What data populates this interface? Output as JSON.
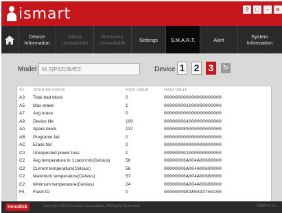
{
  "app": {
    "brand": "ismart"
  },
  "window_buttons": [
    "?",
    "□",
    "–",
    "×"
  ],
  "nav": {
    "home_icon": "home-icon",
    "items": [
      {
        "label": "Device Information",
        "state": "enabled"
      },
      {
        "label": "Ghost Unavailable",
        "state": "disabled"
      },
      {
        "label": "Recovery Unavailable",
        "state": "disabled"
      },
      {
        "label": "Settings",
        "state": "enabled"
      },
      {
        "label": "S.M.A.R.T.",
        "state": "active"
      },
      {
        "label": "Alert",
        "state": "enabled"
      },
      {
        "label": "System Information",
        "state": "enabled"
      }
    ]
  },
  "model": {
    "label": "Model",
    "value": "M.2(P42)3ME2"
  },
  "device": {
    "label": "Device",
    "buttons": [
      "1",
      "2",
      "3"
    ],
    "selected": "3",
    "refresh_icon": "refresh-icon"
  },
  "table": {
    "headers": [
      "ID",
      "Attribute Name",
      "Raw Value",
      "Raw Value"
    ],
    "rows": [
      [
        "A3",
        "Total bad block",
        "0",
        "000000000000000000000"
      ],
      [
        "A5",
        "Max erase",
        "1",
        "000000001000000000000"
      ],
      [
        "A7",
        "Avg erase",
        "0",
        "000000000000000000000"
      ],
      [
        "A9",
        "Device life",
        "100",
        "000000064000000000000"
      ],
      [
        "AA",
        "Spare block",
        "137",
        "000000089000000000000"
      ],
      [
        "AB",
        "Programe fail",
        "0",
        "000000000000000000000"
      ],
      [
        "AC",
        "Erase fail",
        "0",
        "000000000000000000000"
      ],
      [
        "C0",
        "Unexpected power loss",
        "1",
        "000000001000000000000"
      ],
      [
        "C2",
        "Avg temperature in 1 past min(Celsius)",
        "56",
        "00000006A004A00680000"
      ],
      [
        "C2",
        "Current temperature(Celsius)",
        "56",
        "00000006A004A00680000"
      ],
      [
        "C2",
        "Maximum temperature(Celsius)",
        "57",
        "00000006A004A00680000"
      ],
      [
        "C2",
        "Minimum temperature(Celsius)",
        "24",
        "00000006A004A00680000"
      ],
      [
        "F5",
        "Flash ID",
        "0",
        "0000000983A9493760100"
      ]
    ]
  },
  "footer": {
    "brand": "innodisk",
    "copyright": "Copyright 2015 Innodisk Corporation. All Rights Reserved.",
    "version": "iSMART 6.x"
  },
  "colors": {
    "accent": "#c5161c",
    "nav_bg": "#2a2a2a",
    "active_tab": "#0a0a0a",
    "content_bg": "#d9d9d9"
  }
}
